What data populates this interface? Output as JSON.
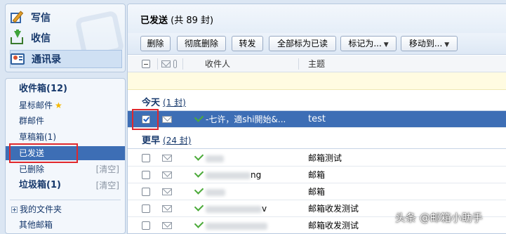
{
  "sidebar": {
    "quick": [
      {
        "label": "写信",
        "icon": "write-icon"
      },
      {
        "label": "收信",
        "icon": "receive-icon"
      },
      {
        "label": "通讯录",
        "icon": "address-book-icon"
      }
    ],
    "folders": {
      "inbox": "收件箱(12)",
      "starred": "星标邮件",
      "group": "群邮件",
      "drafts": "草稿箱(1)",
      "sent": "已发送",
      "deleted": "已删除",
      "deleted_clear": "[清空]",
      "spam": "垃圾箱(1)",
      "spam_clear": "[清空]",
      "my_folders": "我的文件夹",
      "other": "其他邮箱"
    }
  },
  "main": {
    "title": "已发送",
    "count": "(共 89 封)",
    "toolbar": {
      "delete": "删除",
      "perm_delete": "彻底删除",
      "forward": "转发",
      "mark_all_read": "全部标为已读",
      "mark_as": "标记为...",
      "move_to": "移动到..."
    },
    "columns": {
      "recipient": "收件人",
      "subject": "主题"
    },
    "groups": {
      "today": {
        "label": "今天",
        "count": "(1 封)"
      },
      "earlier": {
        "label": "更早",
        "count": "(24 封)"
      }
    },
    "today_rows": [
      {
        "recipient": "-七许，適shi開始&...",
        "subject": "test",
        "selected": true
      }
    ],
    "earlier_rows": [
      {
        "recipient_visible": "",
        "subject": "邮箱测试"
      },
      {
        "recipient_visible": "ng",
        "subject": "邮箱"
      },
      {
        "recipient_visible": "",
        "subject": "邮箱"
      },
      {
        "recipient_visible": "v",
        "subject": "邮箱收发测试"
      },
      {
        "recipient_visible": "",
        "subject": "邮箱收发测试"
      }
    ]
  },
  "watermark": "头条 @邮箱小助手",
  "colors": {
    "accent": "#3d6eb5",
    "highlight_border": "#e0282c",
    "folder_text": "#16386b"
  }
}
